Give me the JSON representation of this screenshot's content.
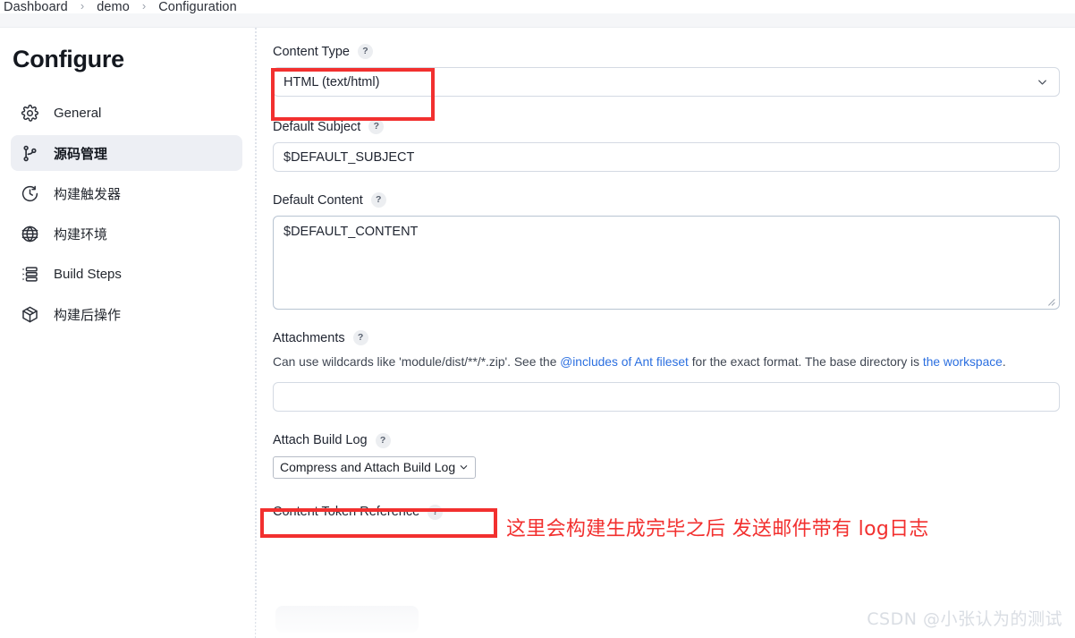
{
  "breadcrumb": {
    "items": [
      {
        "label": "Dashboard"
      },
      {
        "label": "demo"
      },
      {
        "label": "Configuration"
      }
    ],
    "separator": "›"
  },
  "sidebar": {
    "title": "Configure",
    "items": [
      {
        "label": "General",
        "icon": "gear-icon",
        "selected": false
      },
      {
        "label": "源码管理",
        "icon": "git-branch-icon",
        "selected": true
      },
      {
        "label": "构建触发器",
        "icon": "clock-icon",
        "selected": false
      },
      {
        "label": "构建环境",
        "icon": "globe-icon",
        "selected": false
      },
      {
        "label": "Build Steps",
        "icon": "list-steps-icon",
        "selected": false
      },
      {
        "label": "构建后操作",
        "icon": "package-icon",
        "selected": false
      }
    ]
  },
  "form": {
    "help_glyph": "?",
    "content_type": {
      "label": "Content Type",
      "value": "HTML (text/html)"
    },
    "default_subject": {
      "label": "Default Subject",
      "value": "$DEFAULT_SUBJECT",
      "placeholder": ""
    },
    "default_content": {
      "label": "Default Content",
      "value": "$DEFAULT_CONTENT",
      "placeholder": ""
    },
    "attachments": {
      "label": "Attachments",
      "value": "",
      "placeholder": "",
      "help": {
        "part1": "Can use wildcards like 'module/dist/**/*.zip'. See the ",
        "link1": "@includes of Ant fileset",
        "part2": " for the exact format. The base directory is ",
        "link2": "the workspace",
        "part3": "."
      }
    },
    "attach_build_log": {
      "label": "Attach Build Log",
      "value": "Compress and Attach Build Log"
    },
    "content_token_reference": {
      "label": "Content Token Reference"
    }
  },
  "annotations": {
    "note_text": "这里会构建生成完毕之后 发送邮件带有 log日志",
    "highlight_color": "#f2302f"
  },
  "watermark": {
    "text": "CSDN @小张认为的测试"
  }
}
